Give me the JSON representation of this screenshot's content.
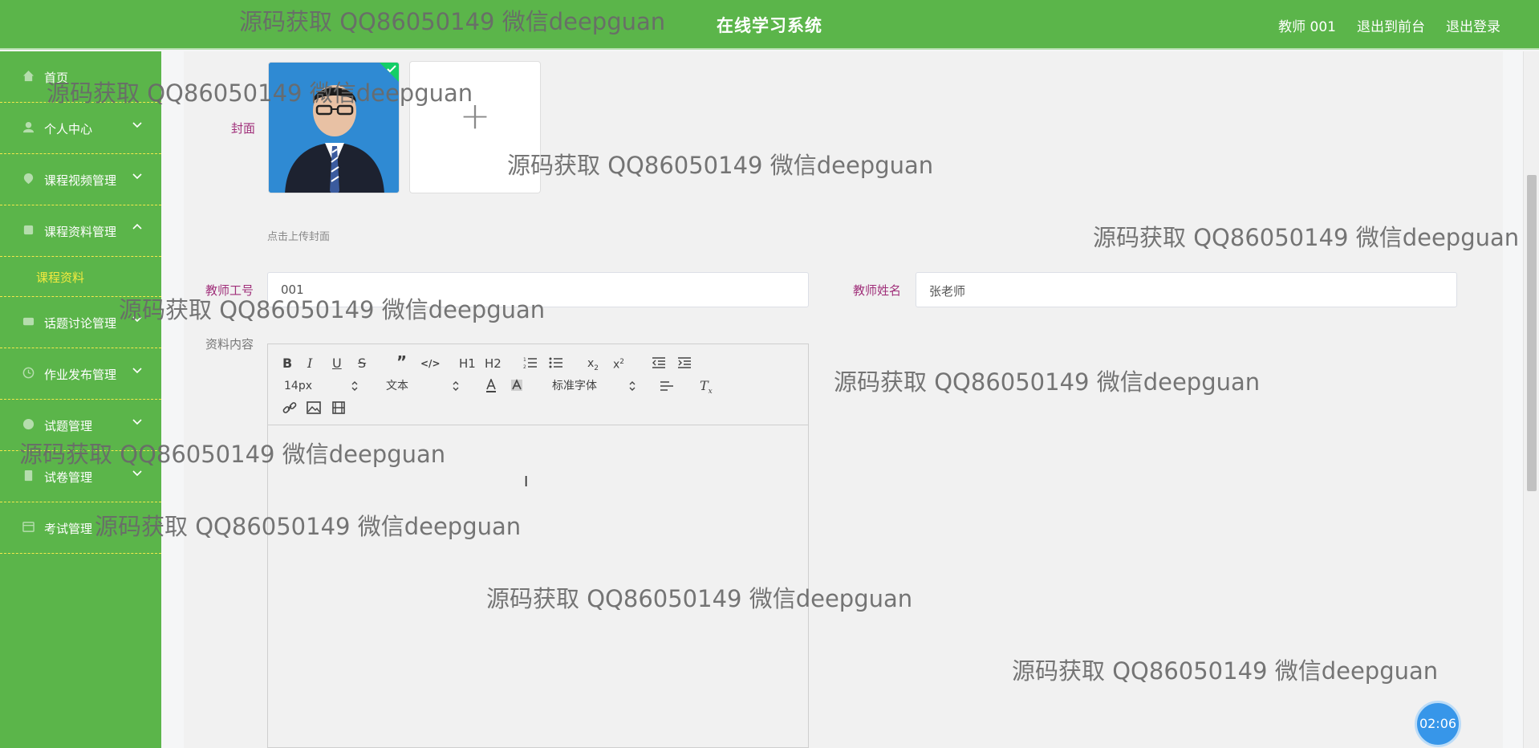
{
  "header": {
    "title": "在线学习系统",
    "user": "教师 001",
    "to_front": "退出到前台",
    "logout": "退出登录"
  },
  "sidebar": {
    "items": [
      {
        "label": "首页",
        "icon": "home-icon",
        "expandable": false
      },
      {
        "label": "个人中心",
        "icon": "user-icon",
        "expandable": true
      },
      {
        "label": "课程视频管理",
        "icon": "video-icon",
        "expandable": true
      },
      {
        "label": "课程资料管理",
        "icon": "document-icon",
        "expandable": true,
        "expanded": true
      },
      {
        "label": "话题讨论管理",
        "icon": "chat-icon",
        "expandable": true
      },
      {
        "label": "作业发布管理",
        "icon": "clock-icon",
        "expandable": true
      },
      {
        "label": "试题管理",
        "icon": "question-icon",
        "expandable": true
      },
      {
        "label": "试卷管理",
        "icon": "paper-icon",
        "expandable": true
      },
      {
        "label": "考试管理",
        "icon": "exam-icon",
        "expandable": false
      }
    ],
    "sub_item": "课程资料"
  },
  "form": {
    "cover_label": "封面",
    "cover_hint": "点击上传封面",
    "teacher_no_label": "教师工号",
    "teacher_no_value": "001",
    "teacher_name_label": "教师姓名",
    "teacher_name_value": "张老师",
    "content_label": "资料内容"
  },
  "editor": {
    "font_size": "14px",
    "text_type": "文本",
    "font_family": "标准字体",
    "heading1": "H1",
    "heading2": "H2"
  },
  "watermark": "源码获取 QQ86050149 微信deepguan",
  "timer": "02:06",
  "colors": {
    "primary_green": "#5bb54a",
    "sidebar_accent_yellow": "#f3ea3f",
    "label_purple": "#a0307a",
    "timer_blue": "#3796e9"
  }
}
